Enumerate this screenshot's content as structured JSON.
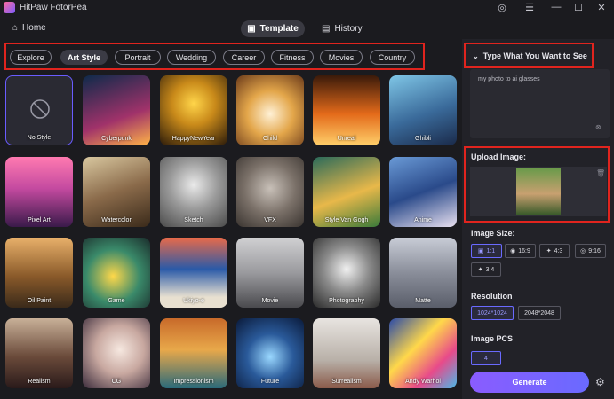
{
  "app": {
    "title": "HitPaw FotorPea"
  },
  "nav": {
    "home": "Home",
    "template": "Template",
    "history": "History"
  },
  "categories": [
    "Explore",
    "Art Style",
    "Portrait",
    "Wedding",
    "Career",
    "Fitness",
    "Movies",
    "Country"
  ],
  "active_category": "Art Style",
  "styles": [
    "No Style",
    "Cyberpunk",
    "HappyNewYear",
    "Child",
    "Unreal",
    "Ghibli",
    "Pixel Art",
    "Watercolor",
    "Sketch",
    "VFX",
    "Style Van Gogh",
    "Anime",
    "Oil Paint",
    "Game",
    "Ukiyo-e",
    "Movie",
    "Photography",
    "Matte",
    "Realism",
    "CG",
    "Impressionism",
    "Future",
    "Surrealism",
    "Andy Warhol"
  ],
  "panel": {
    "prompt_title": "Type What You Want to See",
    "prompt_value": "my photo to ai glasses",
    "upload_title": "Upload Image:",
    "image_size_title": "Image Size:",
    "sizes": [
      "1:1",
      "16:9",
      "4:3",
      "9:16",
      "3:4"
    ],
    "selected_size": "1:1",
    "resolution_title": "Resolution",
    "resolutions": [
      "1024*1024",
      "2048*2048"
    ],
    "selected_resolution": "1024*1024",
    "pcs_title": "Image PCS",
    "pcs_value": "4",
    "generate": "Generate"
  },
  "colors": {
    "accent": "#6a6aff",
    "highlight": "#e0241e",
    "bg": "#1b1b1f"
  }
}
